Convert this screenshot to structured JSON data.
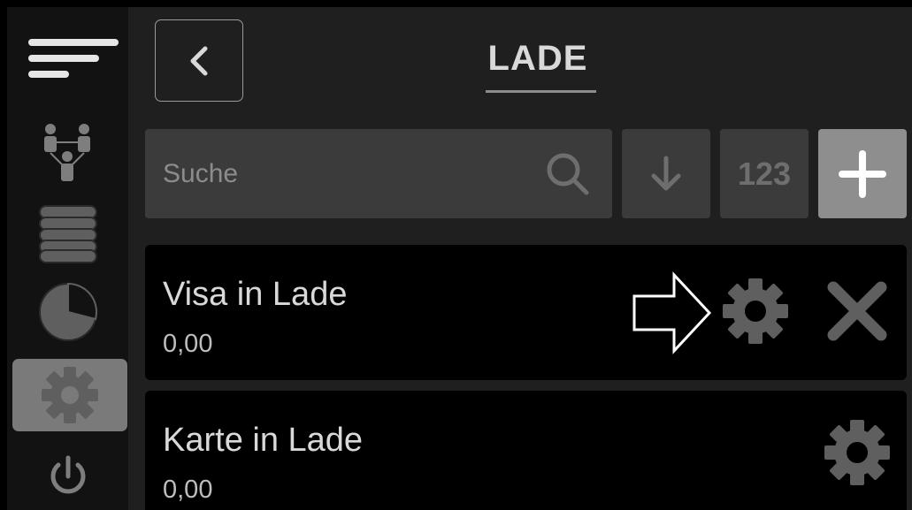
{
  "header": {
    "title": "LADE"
  },
  "toolbar": {
    "search_placeholder": "Suche",
    "numeric_label": "123"
  },
  "items": [
    {
      "name": "Visa in Lade",
      "amount": "0,00"
    },
    {
      "name": "Karte in Lade",
      "amount": "0,00"
    }
  ],
  "sidebar": {
    "active_item": "settings",
    "items": [
      "menu-icon",
      "users-icon",
      "coins-icon",
      "pie-chart-icon",
      "gear-icon",
      "power-icon"
    ]
  },
  "colors": {
    "background": "#1f1f1f",
    "sidebar": "#121212",
    "active_sidebar": "#7a7a7a",
    "button": "#3b3b3b",
    "add_button": "#8e8e8e",
    "text": "#d9d9d9",
    "list_item": "#000000"
  }
}
